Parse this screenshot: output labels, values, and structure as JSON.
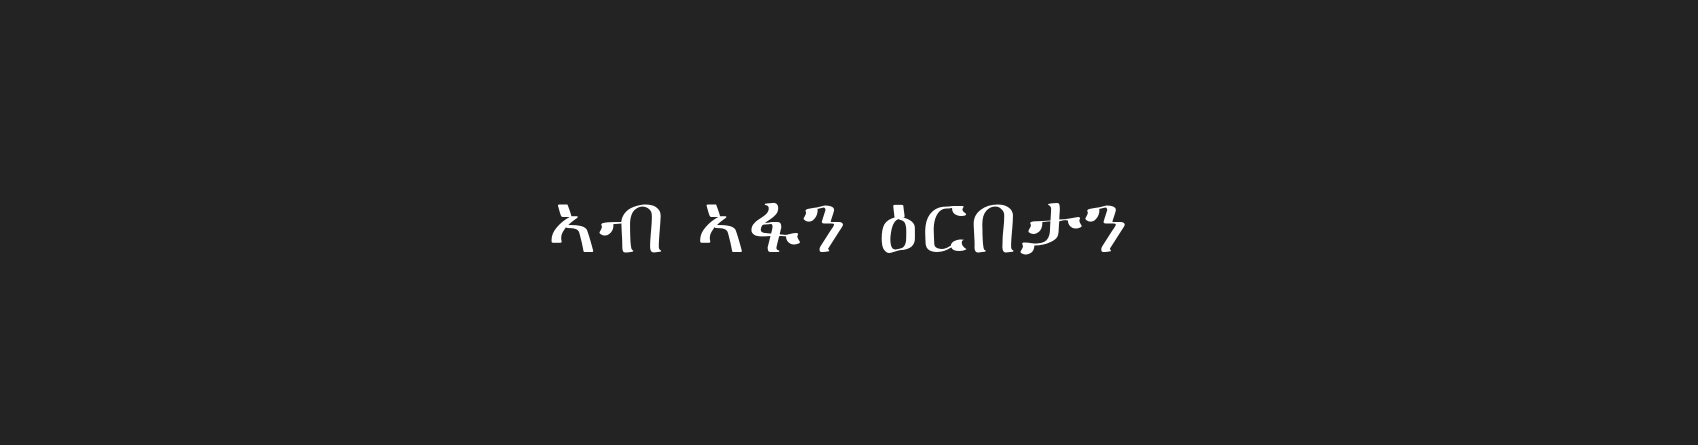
{
  "caption": {
    "text": "ኣብ ኣፋን ዕርበታን"
  },
  "colors": {
    "background": "#232323",
    "text": "#ffffff"
  }
}
